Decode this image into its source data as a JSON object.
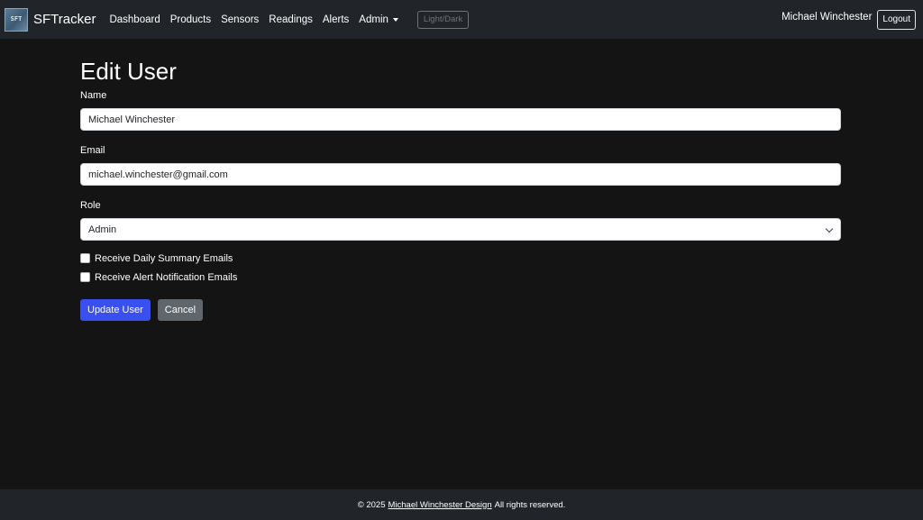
{
  "navbar": {
    "brand": {
      "logo_text": "SFT",
      "name": "SFTracker"
    },
    "links": [
      "Dashboard",
      "Products",
      "Sensors",
      "Readings",
      "Alerts"
    ],
    "admin_label": "Admin",
    "theme_toggle": "Light/Dark",
    "user_name": "Michael Winchester",
    "logout_label": "Logout"
  },
  "page": {
    "title": "Edit User",
    "fields": {
      "name_label": "Name",
      "name_value": "Michael Winchester",
      "email_label": "Email",
      "email_value": "michael.winchester@gmail.com",
      "role_label": "Role",
      "role_value": "Admin"
    },
    "checkboxes": [
      {
        "label": "Receive Daily Summary Emails",
        "checked": false
      },
      {
        "label": "Receive Alert Notification Emails",
        "checked": false
      }
    ],
    "buttons": {
      "update": "Update User",
      "cancel": "Cancel"
    }
  },
  "footer": {
    "prefix": "© 2025",
    "link": "Michael Winchester Design",
    "suffix": "All rights reserved."
  },
  "colors": {
    "background": "#141414",
    "navbar": "#212529",
    "primary": "#3a4ff0",
    "secondary": "#5f666c"
  }
}
